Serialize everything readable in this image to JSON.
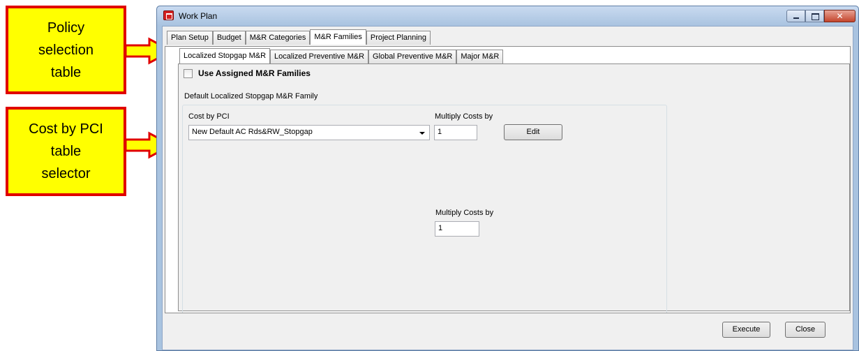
{
  "callouts": [
    {
      "text": "Policy\nselection\ntable"
    },
    {
      "text": "Cost by PCI\ntable\nselector"
    }
  ],
  "window": {
    "title": "Work Plan",
    "outer_tabs": [
      "Plan Setup",
      "Budget",
      "M&R Categories",
      "M&R Families",
      "Project Planning"
    ],
    "outer_active": "M&R Families",
    "inner_tabs": [
      "Localized Stopgap M&R",
      "Localized Preventive M&R",
      "Global Preventive M&R",
      "Major M&R"
    ],
    "inner_active": "Localized Stopgap M&R"
  },
  "panel": {
    "use_assigned_label": "Use Assigned M&R Families",
    "use_assigned_checked": false,
    "default_family_label": "Default Localized Stopgap M&R Family",
    "cost_by_pci_label": "Cost by PCI",
    "cost_by_pci_value": "New Default AC Rds&RW_Stopgap",
    "multiply_label_1": "Multiply Costs by",
    "multiply_value_1": "1",
    "edit_label": "Edit",
    "multiply_label_2": "Multiply Costs by",
    "multiply_value_2": "1"
  },
  "footer": {
    "execute_label": "Execute",
    "close_label": "Close"
  },
  "colors": {
    "callout_bg": "#ffff00",
    "callout_border": "#e00000",
    "window_frame": "#a9c3e0"
  }
}
